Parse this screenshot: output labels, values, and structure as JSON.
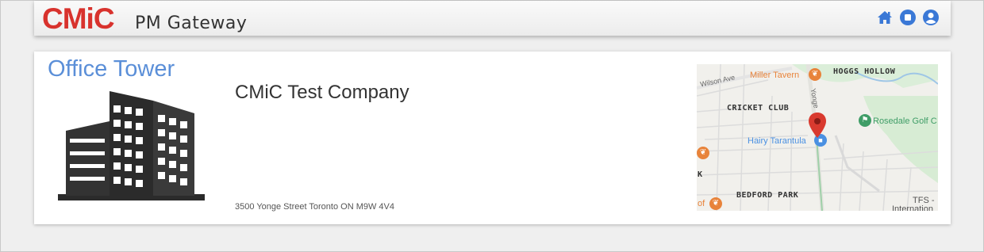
{
  "header": {
    "logo_main": "CM",
    "logo_i": "i",
    "logo_c": "C",
    "app_name": "PM Gateway",
    "icons": [
      "home-icon",
      "stop-icon",
      "user-icon"
    ],
    "accent": "#3a78d6"
  },
  "project": {
    "title": "Office Tower",
    "company": "CMiC Test Company",
    "address": "3500 Yonge Street Toronto ON M9W 4V4"
  },
  "map": {
    "labels": {
      "hoggs_hollow": "HOGGS HOLLOW",
      "cricket_club": "CRICKET CLUB",
      "bedford_park": "BEDFORD PARK",
      "tfs": "TFS -",
      "international": "Internation",
      "wilson_ave": "Wilson Ave",
      "yonge": "Yonge",
      "k": "K",
      "of": "of"
    },
    "pois": {
      "miller_tavern": "Miller Tavern",
      "rosedale_golf": "Rosedale Golf C",
      "hairy_tarantula": "Hairy Tarantula"
    },
    "colors": {
      "restaurant": "#e8833a",
      "park": "#3f9d67",
      "shop": "#4a90e2",
      "pin": "#d93a2f"
    }
  }
}
